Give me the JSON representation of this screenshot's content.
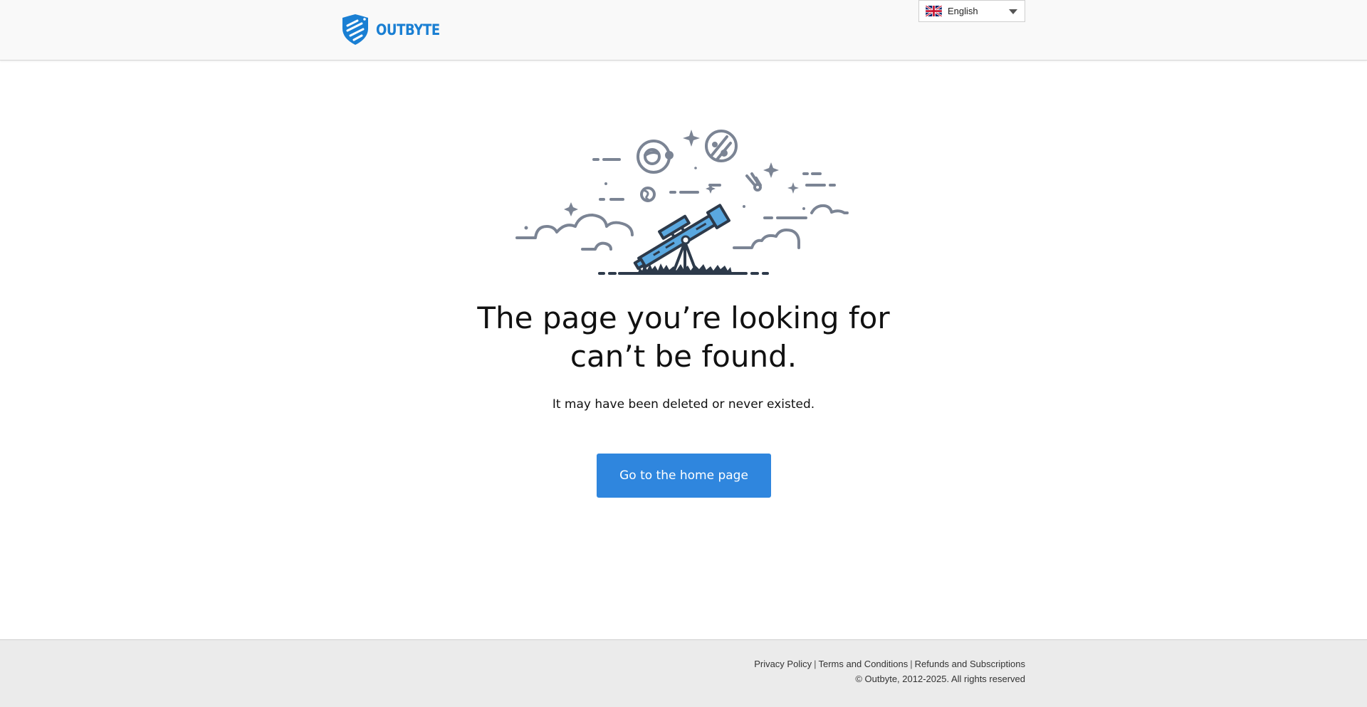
{
  "header": {
    "logo_text": "OUTBYTE",
    "logo_icon": "shield-logo-icon",
    "language": {
      "selected": "English",
      "flag_icon": "uk-flag-icon",
      "caret_icon": "caret-down-icon"
    }
  },
  "main": {
    "illustration_icon": "telescope-space-illustration",
    "title_line1": "The page you’re looking for",
    "title_line2": "can’t be found.",
    "subtitle": "It may have been deleted or never existed.",
    "home_button_label": "Go to the home page"
  },
  "footer": {
    "links": [
      "Privacy Policy",
      "Terms and Conditions",
      "Refunds and Subscriptions"
    ],
    "separator": "|",
    "copyright": "© Outbyte, 2012-2025. All rights reserved"
  },
  "colors": {
    "brand": "#1a7fd3",
    "button": "#2f86de",
    "header_bg": "#f9f9f9",
    "footer_bg": "#ebebeb",
    "illustration_gray": "#7b8494",
    "illustration_dark": "#2d3a4a",
    "telescope_blue": "#5aa8e0"
  }
}
